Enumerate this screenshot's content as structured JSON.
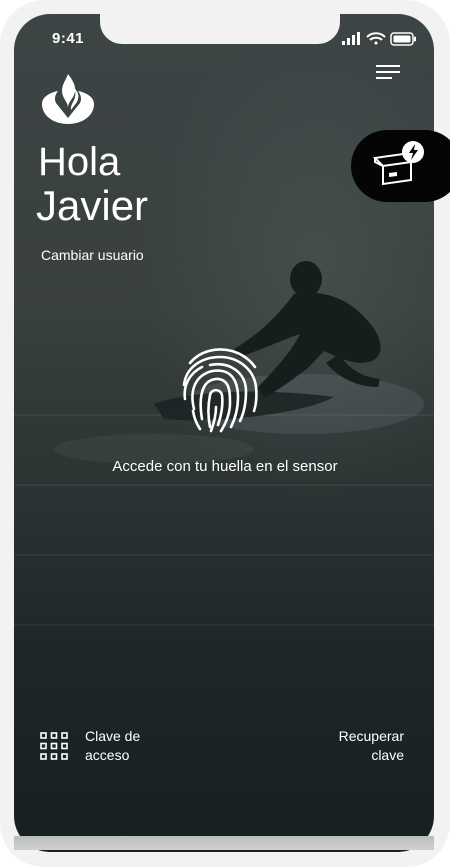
{
  "status_bar": {
    "time": "9:41"
  },
  "greeting": {
    "hello": "Hola",
    "name": "Javier"
  },
  "change_user_label": "Cambiar usuario",
  "fingerprint": {
    "instruction": "Accede con tu huella en el sensor"
  },
  "footer": {
    "access_key_label_line1": "Clave de",
    "access_key_label_line2": "acceso",
    "recover_label_line1": "Recuperar",
    "recover_label_line2": "clave"
  },
  "icons": {
    "logo": "santander-flame-icon",
    "menu": "hamburger-menu-icon",
    "promo": "offer-box-lightning-icon",
    "fingerprint": "fingerprint-icon",
    "keypad": "keypad-grid-icon"
  },
  "colors": {
    "text": "#ffffff",
    "background_dark": "#2c3434",
    "promo_bg": "#050505"
  }
}
